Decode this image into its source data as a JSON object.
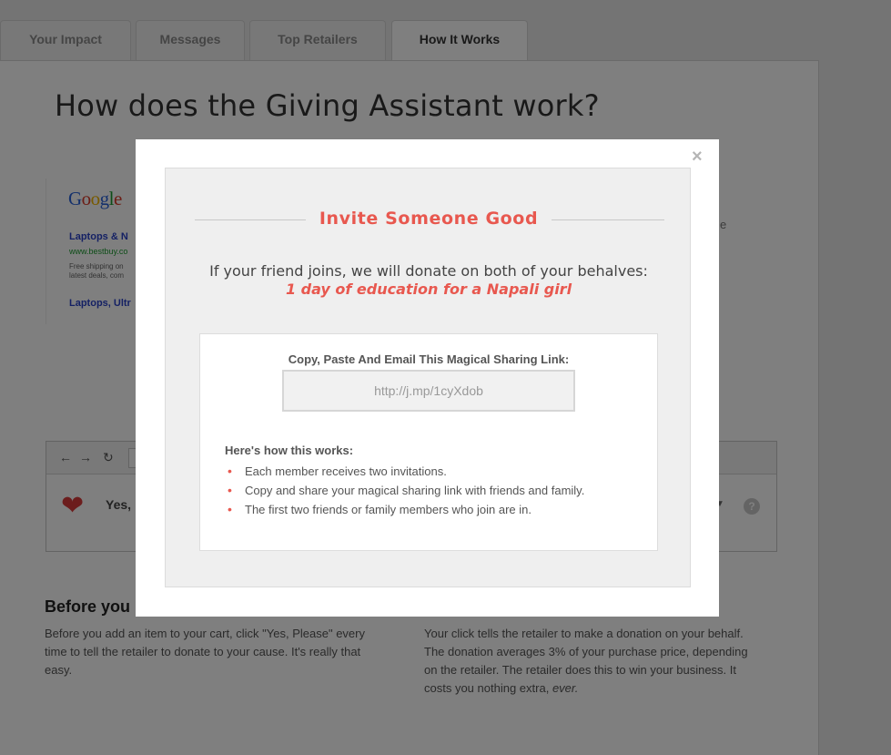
{
  "tabs": [
    {
      "label": "Your Impact"
    },
    {
      "label": "Messages"
    },
    {
      "label": "Top Retailers"
    },
    {
      "label": "How It Works"
    }
  ],
  "page": {
    "title": "How does the Giving Assistant work?",
    "serp": {
      "logo": "Google",
      "result1_title": "Laptops & N",
      "result1_url": "www.bestbuy.co",
      "result1_desc": "Free shipping on latest deals, com",
      "result2_title": "Laptops, Ultr"
    },
    "right_fragment": "e",
    "browser": {
      "yes_text": "Yes,"
    },
    "col1": {
      "heading": "Before you",
      "text": "Before you add an item to your cart, click \"Yes, Please\" every time to tell the retailer to donate to your cause. It's really that easy."
    },
    "col2": {
      "text_part1": "Your click tells the retailer to make a donation on your behalf. The donation averages 3% of your purchase price, depending on the retailer. The retailer does this to win your business. It costs you nothing extra,",
      "text_em": "ever."
    }
  },
  "modal": {
    "close": "×",
    "title": "Invite Someone Good",
    "lead": "If your friend joins, we will donate on both of your behalves:",
    "accent": "1 day of education for a Napali girl",
    "card_label": "Copy, Paste And Email This Magical Sharing Link:",
    "share_link": "http://j.mp/1cyXdob",
    "how_heading": "Here's how this works:",
    "how_items": [
      "Each member receives two invitations.",
      "Copy and share your magical sharing link with friends and family.",
      "The first two friends or family members who join are in."
    ]
  },
  "colors": {
    "accent": "#e8584f",
    "overlay": "rgba(0,0,0,0.5)"
  }
}
